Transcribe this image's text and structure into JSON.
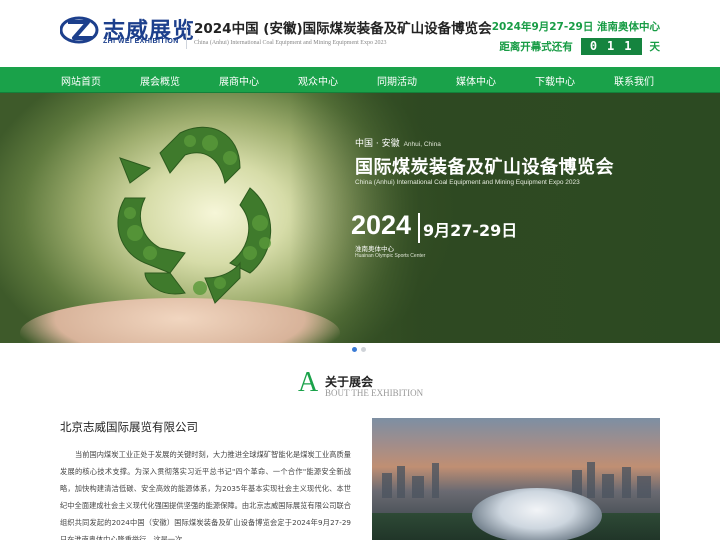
{
  "header": {
    "logo_cn": "志威展览",
    "logo_en": "ZHI WEI EXHIBITION",
    "title": "2024中国 (安徽)国际煤炭装备及矿山设备博览会",
    "subtitle": "China (Anhui) International Coal Equipment and Mining Equipment Expo 2023",
    "date_venue": "2024年9月27-29日 淮南奥体中心",
    "countdown_prefix": "距离开幕式还有",
    "countdown_value": "011",
    "countdown_suffix": "天"
  },
  "nav": {
    "items": [
      {
        "label": "网站首页"
      },
      {
        "label": "展会概览"
      },
      {
        "label": "展商中心"
      },
      {
        "label": "观众中心"
      },
      {
        "label": "同期活动"
      },
      {
        "label": "媒体中心"
      },
      {
        "label": "下载中心"
      },
      {
        "label": "联系我们"
      }
    ]
  },
  "banner": {
    "location_cn": "中国 · 安徽",
    "location_en": "Anhui, China",
    "title": "国际煤炭装备及矿山设备博览会",
    "subtitle_en": "China (Anhui) International Coal Equipment and Mining Equipment Expo 2023",
    "year": "2024",
    "dates": "9月27-29日",
    "venue_cn": "淮南奥体中心",
    "venue_en": "Huainan Olympic Sports Center",
    "slide_count": 2,
    "active_slide": 1
  },
  "about": {
    "letter": "A",
    "title": "关于展会",
    "title_en": "BOUT THE EXHIBITION",
    "company": "北京志威国际展览有限公司",
    "text": "当前国内煤炭工业正处于发展的关键时刻，大力推进全球煤矿智能化是煤炭工业高质量发展的核心技术支撑。为深入贯彻落实习近平总书记\"四个革命、一个合作\"能源安全新战略，加快构建清洁低碳、安全高效的能源体系，为2035年基本实现社会主义现代化、本世纪中全面建成社会主义现代化强国提供坚强的能源保障。由北京志威国际展览有限公司联合组织共同发起的2024中国（安徽）国际煤炭装备及矿山设备博览会定于2024年9月27-29日在淮南奥体中心隆重举行，这是一次"
  },
  "colors": {
    "brand_green": "#1aa24a",
    "brand_blue": "#1c3f8c",
    "dot_active": "#3a7bd5"
  }
}
